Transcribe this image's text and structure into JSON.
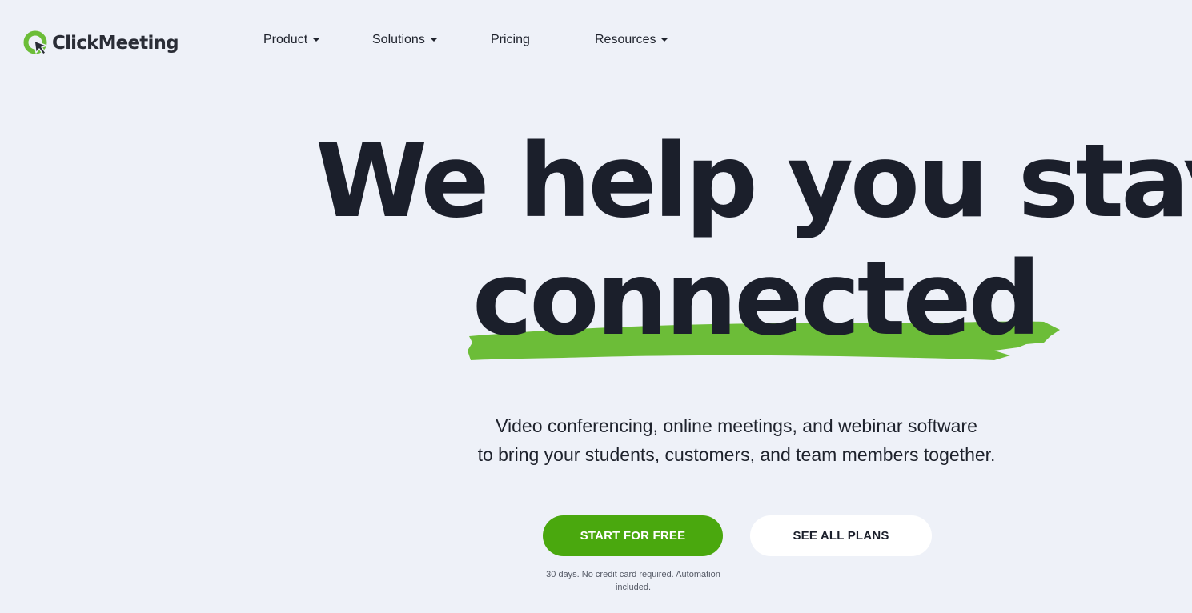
{
  "header": {
    "brand": "ClickMeeting",
    "nav": [
      {
        "label": "Product",
        "has_dropdown": true
      },
      {
        "label": "Solutions",
        "has_dropdown": true
      },
      {
        "label": "Pricing",
        "has_dropdown": false
      },
      {
        "label": "Resources",
        "has_dropdown": true
      }
    ]
  },
  "hero": {
    "headline_line1": "We help you stay",
    "headline_line2": "connected",
    "subtext_line1": "Video conferencing, online meetings, and webinar software",
    "subtext_line2": "to bring your students, customers, and team members together.",
    "primary_cta": "START FOR FREE",
    "secondary_cta": "SEE ALL PLANS",
    "fine_print_line1": "30 days. No credit card required. Automation",
    "fine_print_line2": "included."
  },
  "colors": {
    "background": "#eef1f8",
    "brand_green": "#4aa80e",
    "highlight_green": "#6cbd38",
    "text_dark": "#1b1f2b"
  },
  "icons": {
    "logo": "clickmeeting-logo-icon",
    "dropdown": "caret-down-icon"
  }
}
